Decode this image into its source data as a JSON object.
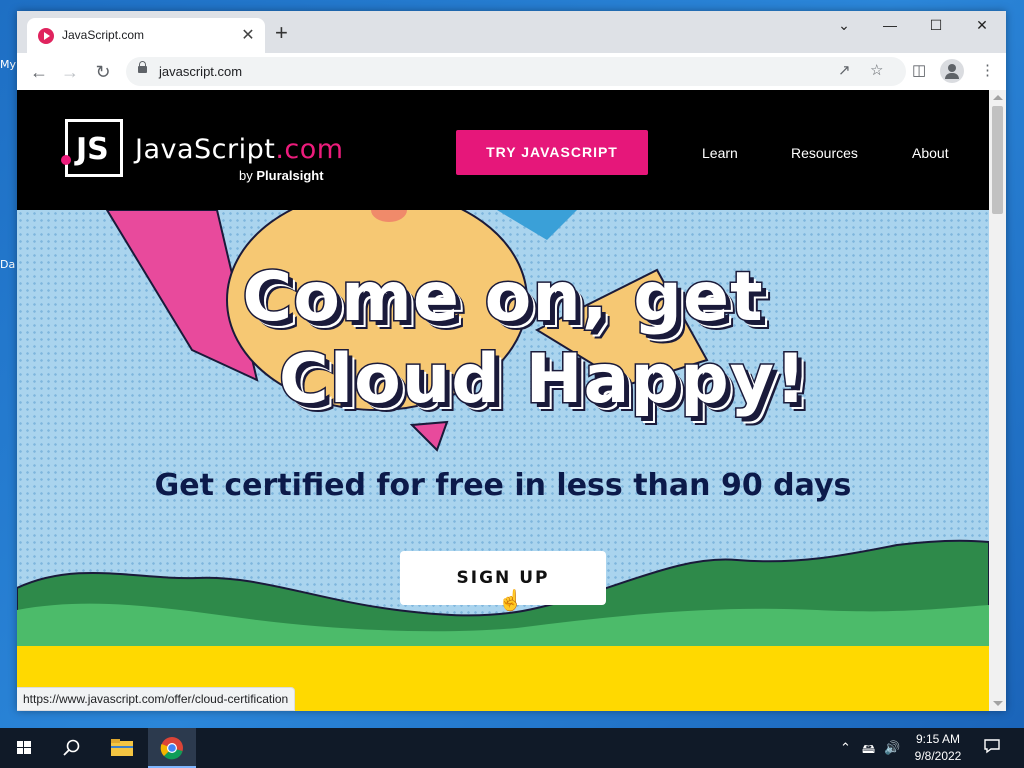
{
  "desktop": {
    "label1": "My",
    "label2": "Da"
  },
  "browser": {
    "tab_title": "JavaScript.com",
    "tab_close": "✕",
    "new_tab": "+",
    "url": "javascript.com",
    "window_controls": {
      "dropdown": "⌄",
      "minimize": "—",
      "maximize": "☐",
      "close": "✕"
    }
  },
  "site": {
    "logo_mark": "JS",
    "brand_name": "JavaScript",
    "brand_tld": ".com",
    "byline_prefix": "by",
    "byline_company": "Pluralsight",
    "cta_button": "TRY JAVASCRIPT",
    "nav": [
      {
        "label": "Learn"
      },
      {
        "label": "Resources"
      },
      {
        "label": "About"
      }
    ],
    "hero": {
      "headline_line1": "Come on, get",
      "headline_line2": "Cloud Happy!",
      "subheadline": "Get certified for free in less than 90 days",
      "signup_button": "SIGN UP"
    }
  },
  "status_bar": {
    "link_preview": "https://www.javascript.com/offer/cloud-certification"
  },
  "taskbar": {
    "time": "9:15 AM",
    "date": "9/8/2022",
    "items": [
      "windows-start",
      "search",
      "file-explorer",
      "chrome"
    ]
  },
  "colors": {
    "brand_pink": "#e6177a",
    "hero_bg": "#aad4ee",
    "yellow_band": "#ffd900",
    "dark_navy": "#0c1a4a"
  }
}
